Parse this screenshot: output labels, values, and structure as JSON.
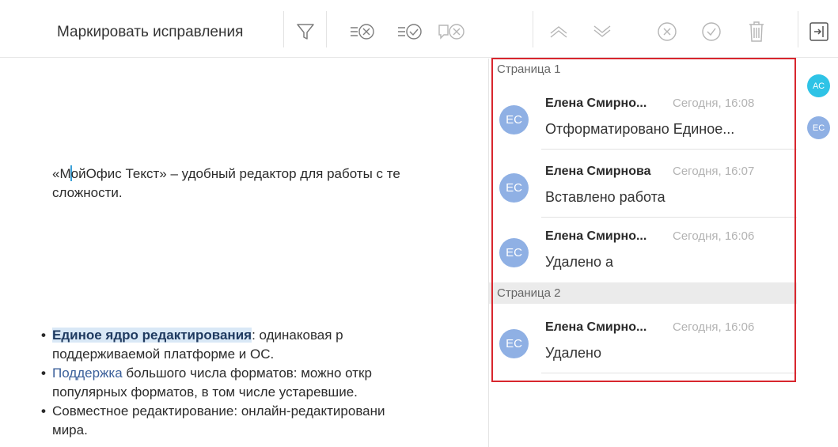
{
  "toolbar": {
    "mark_changes_label": "Маркировать исправления",
    "icons": [
      "filter-icon",
      "reject-all-icon",
      "accept-all-icon",
      "delete-comments-icon",
      "previous-change-icon",
      "next-change-icon",
      "reject-icon",
      "accept-icon",
      "trash-icon",
      "toggle-panel-icon"
    ],
    "accent": "#8a8a8a"
  },
  "document": {
    "para1_line1_a": "«М",
    "para1_line1_b": "ойОфис Текст» – удобный редактор для работы с те",
    "para1_line2": "сложности.",
    "list": [
      {
        "bullet": "•",
        "hl": "Единое ядро редактирования",
        "rest": ":  одинаковая  р",
        "line2": "поддерживаемой платформе и ОС."
      },
      {
        "bullet": "•",
        "blue": "Поддержка",
        "rest": " большого числа форматов: можно откр",
        "line2": "популярных форматов, в том числе устаревшие."
      },
      {
        "bullet": "•",
        "rest": "Совместное редактирование: онлайн-редактировани",
        "line2": "мира."
      }
    ]
  },
  "panel": {
    "pages": [
      {
        "header": "Страница 1",
        "comments": [
          {
            "avatar": "ЕС",
            "author": "Елена Смирно...",
            "time": "Сегодня, 16:08",
            "text": "Отформатировано Единое..."
          },
          {
            "avatar": "ЕС",
            "author": "Елена Смирнова",
            "time": "Сегодня, 16:07",
            "text": "Вставлено  работа"
          },
          {
            "avatar": "ЕС",
            "author": "Елена Смирно...",
            "time": "Сегодня, 16:06",
            "text": "Удалено  а"
          }
        ]
      },
      {
        "header": "Страница 2",
        "comments": [
          {
            "avatar": "ЕС",
            "author": "Елена Смирно...",
            "time": "Сегодня, 16:06",
            "text": "Удалено"
          }
        ]
      }
    ],
    "highlight_color": "#d8262e",
    "avatar_color": "#8fb0e4"
  },
  "users": [
    {
      "initials": "АС",
      "color": "#2ec3e6"
    },
    {
      "initials": "ЕС",
      "color": "#8fb0e4"
    }
  ]
}
